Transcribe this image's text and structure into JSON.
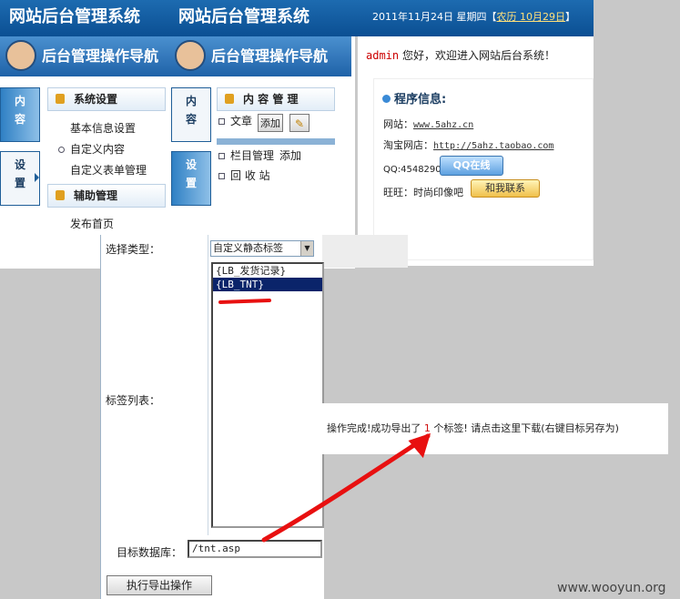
{
  "header": {
    "title_left": "网站后台管理系统",
    "title_right": "网站后台管理系统",
    "date": "2011年11月24日 星期四【",
    "lunar": "农历 10月29日",
    "date_close": "】"
  },
  "nav": {
    "title": "后台管理操作导航",
    "watermark": "后台管理操作导航"
  },
  "tabs_left": [
    "内容",
    "设置"
  ],
  "menu_left": {
    "section1": "系统设置",
    "items1": [
      "基本信息设置",
      "自定义内容",
      "自定义表单管理"
    ],
    "section2": "辅助管理",
    "items2": [
      "发布首页"
    ]
  },
  "tabs_right": [
    "内容",
    "设置"
  ],
  "menu_right": {
    "section": "内 容 管 理",
    "article": "文章",
    "add": "添加",
    "column": "栏目管理",
    "column_add": "添加",
    "recycle": "回 收 站"
  },
  "welcome": {
    "user": "admin",
    "text": "您好，欢迎进入网站后台系统！"
  },
  "info": {
    "title": "程序信息:",
    "site_label": "网站：",
    "site_url": "www.5ahz.cn",
    "shop_label": "淘宝网店：",
    "shop_url": "http://5ahz.taobao.com",
    "qq_label": "QQ:4548290",
    "qq_button": "QQ在线",
    "wangwang_label": "旺旺：时尚印像吧",
    "wangwang_button": "和我联系"
  },
  "export_form": {
    "type_label": "选择类型：",
    "type_value": "自定义静态标签",
    "list_label": "标签列表：",
    "options": [
      "{LB_发货记录}",
      "{LB_TNT}"
    ],
    "selected_index": 1,
    "db_label": "目标数据库：",
    "db_value": "/tnt.asp",
    "submit": "执行导出操作"
  },
  "result": {
    "prefix": "操作完成!成功导出了 ",
    "count": "1",
    "suffix": " 个标签! 请点击这里下载(右键目标另存为)"
  },
  "watermark": "www.wooyun.org",
  "colors": {
    "header": "#0b4f93",
    "accent_red": "#e81010",
    "selection": "#0a246a"
  }
}
